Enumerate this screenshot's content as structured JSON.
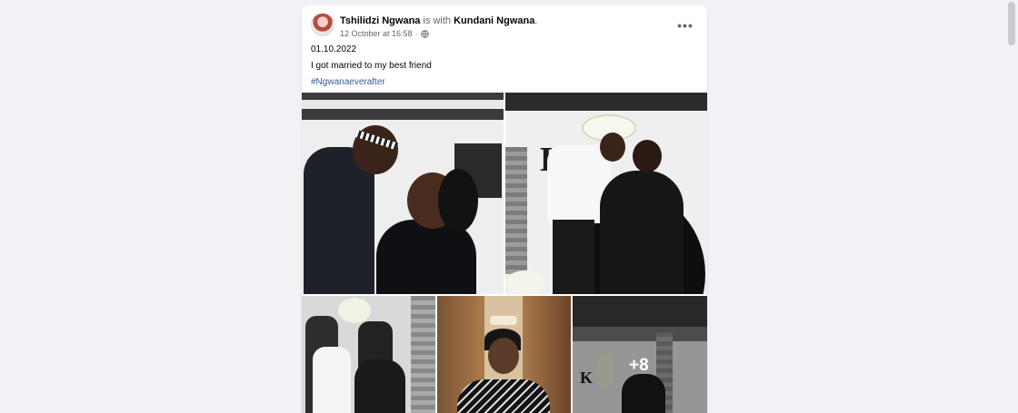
{
  "post": {
    "author": "Tshilidzi Ngwana",
    "with_text": " is with ",
    "tagged": "Kundani Ngwana",
    "tagged_suffix": ".",
    "timestamp": "12 October at 16:58",
    "date_line": "01.10.2022",
    "message": "I got married to my best friend",
    "hashtag": "#Ngwanaeverafter",
    "more_photos": "+8"
  },
  "icons": {
    "menu": "more-horizontal-icon",
    "audience": "globe-icon"
  }
}
